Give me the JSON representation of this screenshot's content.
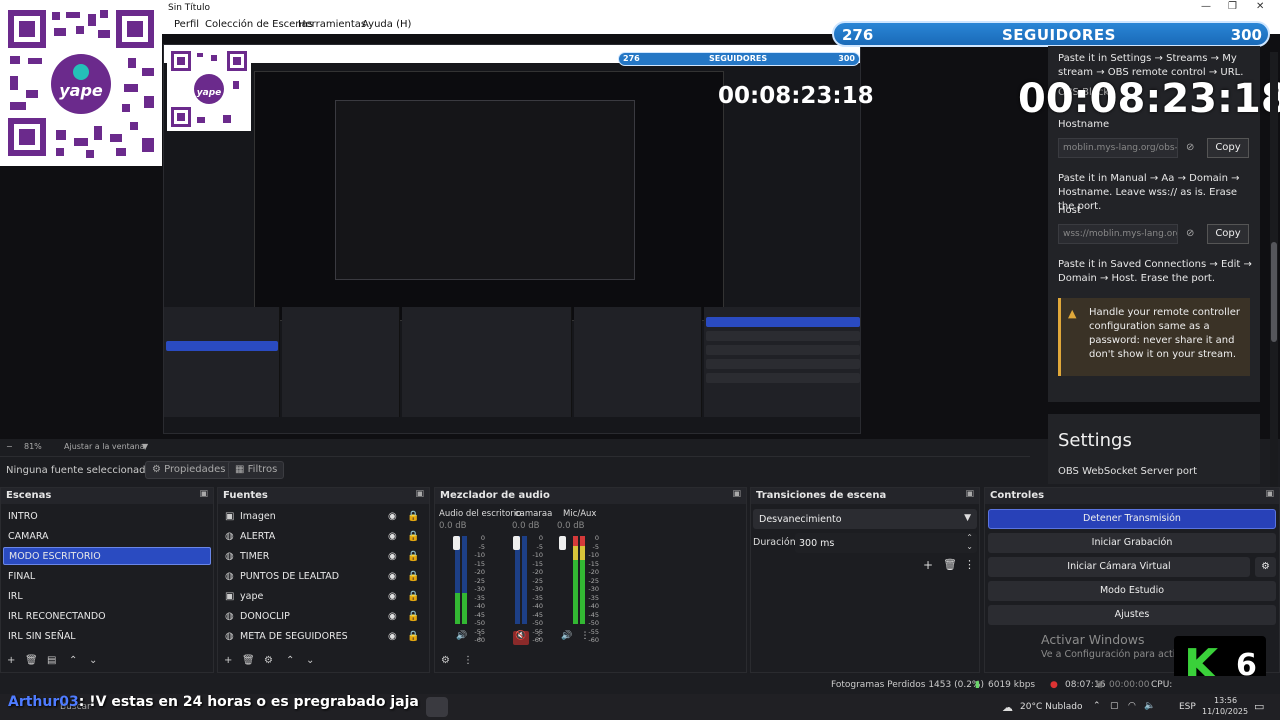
{
  "window": {
    "title": "Sin Título",
    "controls": [
      "—",
      "❐",
      "✕"
    ]
  },
  "menu": [
    "Perfil",
    "Colección de Escenas",
    "Herramientas",
    "Ayuda (H)"
  ],
  "followers_bar": {
    "current": "276",
    "label": "SEGUIDORES",
    "goal": "300"
  },
  "timer": "00:08:23:18",
  "browser_panel": {
    "step1": "Paste it in Settings → Streams → My stream → OBS remote control → URL.",
    "obs_block": "OBS Block",
    "hostname_label": "Hostname",
    "hostname_value": "moblin.mys-lang.org/obs-",
    "copy_label": "Copy",
    "step2": "Paste it in Manual → Aa → Domain → Hostname. Leave wss:// as is. Erase the port.",
    "host_label": "Host",
    "host_value": "wss://moblin.mys-lang.org",
    "step3": "Paste it in Saved Connections → Edit → Domain → Host. Erase the port.",
    "warning": "Handle your remote controller configuration same as a password: never share it and don't show it on your stream.",
    "settings_title": "Settings",
    "settings_sub": "OBS WebSocket Server port"
  },
  "zoom": {
    "value": "81%",
    "fit": "Ajustar a la ventana"
  },
  "source_toolbar": {
    "no_source": "Ninguna fuente seleccionad",
    "properties": "Propiedades",
    "filters": "Filtros"
  },
  "scenes": {
    "title": "Escenas",
    "items": [
      "INTRO",
      "CAMARA",
      "MODO ESCRITORIO",
      "FINAL",
      "IRL",
      "IRL RECONECTANDO",
      "IRL SIN SEÑAL"
    ],
    "selected": "MODO ESCRITORIO"
  },
  "sources": {
    "title": "Fuentes",
    "items": [
      {
        "label": "Imagen",
        "icon": "image-icon"
      },
      {
        "label": "ALERTA",
        "icon": "globe-icon"
      },
      {
        "label": "TIMER",
        "icon": "globe-icon"
      },
      {
        "label": "PUNTOS DE LEALTAD",
        "icon": "globe-icon"
      },
      {
        "label": "yape",
        "icon": "image-icon"
      },
      {
        "label": "DONOCLIP",
        "icon": "globe-icon"
      },
      {
        "label": "META DE SEGUIDORES",
        "icon": "globe-icon"
      }
    ]
  },
  "mixer": {
    "title": "Mezclador de audio",
    "channels": [
      {
        "name": "Audio del escritorio",
        "db": "0.0 dB",
        "level": 0.35
      },
      {
        "name": "camaraa",
        "db": "0.0 dB",
        "level": 0.0,
        "muted": true
      },
      {
        "name": "Mic/Aux",
        "db": "0.0 dB",
        "level": 0.9
      }
    ],
    "scale": [
      "0",
      "-5",
      "-10",
      "-15",
      "-20",
      "-25",
      "-30",
      "-35",
      "-40",
      "-45",
      "-50",
      "-55",
      "-60"
    ]
  },
  "transitions": {
    "title": "Transiciones de escena",
    "selected": "Desvanecimiento",
    "duration_label": "Duración",
    "duration_value": "300 ms"
  },
  "controls": {
    "title": "Controles",
    "stop_stream": "Detener Transmisión",
    "start_record": "Iniciar Grabación",
    "virtual_cam": "Iniciar Cámara Virtual",
    "studio_mode": "Modo Estudio",
    "settings": "Ajustes"
  },
  "activate": {
    "title": "Activar Windows",
    "sub": "Ve a Configuración para activar"
  },
  "kick_badge": {
    "letter": "K",
    "number": "6"
  },
  "status": {
    "dropped": "Fotogramas Perdidos 1453 (0.2%)",
    "bitrate": "6019 kbps",
    "stream_time": "08:07:16",
    "rec_time": "00:00:00",
    "cpu": "CPU:"
  },
  "chat_overlay": {
    "user": "Arthur03",
    "text": "!V estas en 24 horas o es pregrabado jaja"
  },
  "taskbar": {
    "search": "Buscar",
    "weather": "20°C Nublado",
    "lang": "ESP",
    "time": "13:56",
    "date": "11/10/2025"
  },
  "colors": {
    "accent": "#2a4bc1",
    "followers": "#2a86d6",
    "kick_green": "#3ad13a",
    "warn": "#e0a83a"
  }
}
